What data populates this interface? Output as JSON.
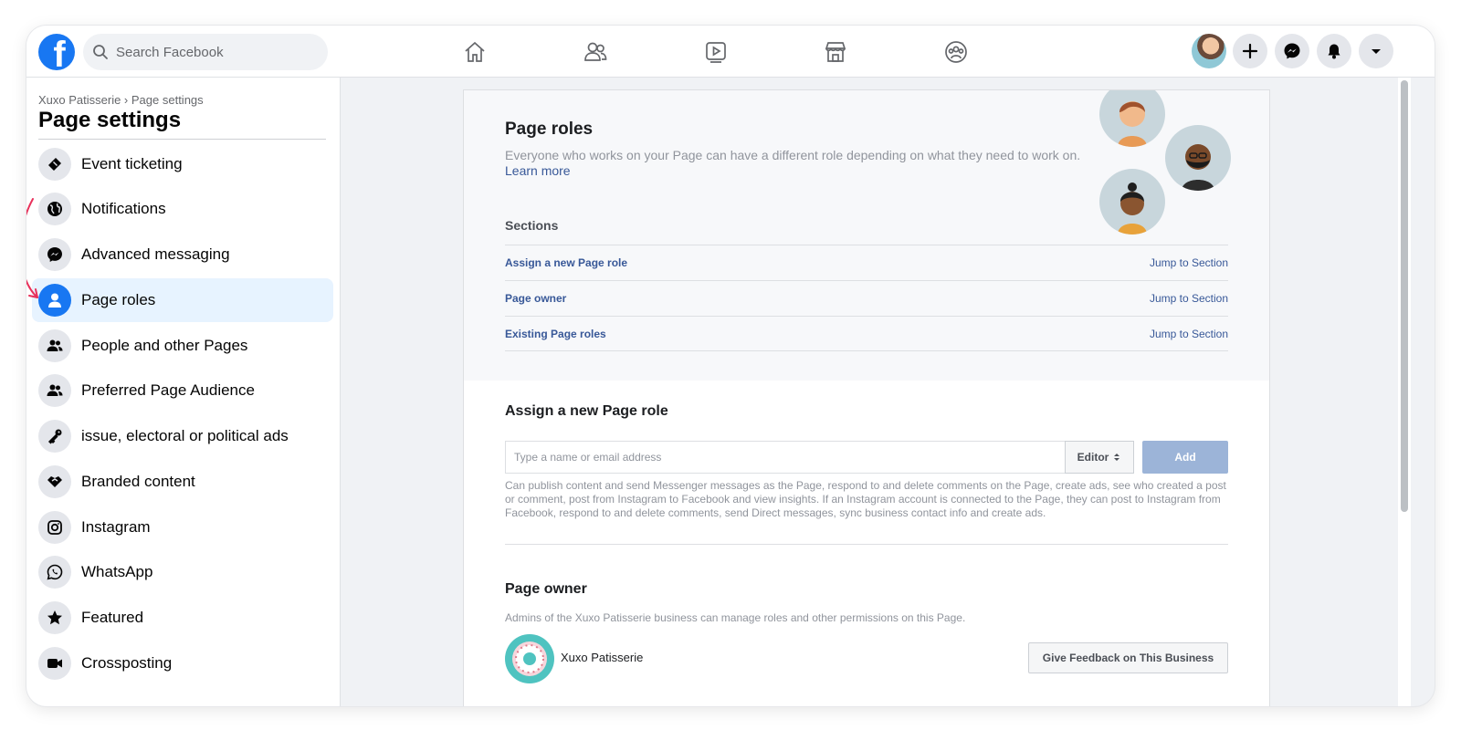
{
  "topbar": {
    "logo_letter": "f",
    "search_placeholder": "Search Facebook",
    "nav_icons": [
      "home-icon",
      "friends-icon",
      "watch-icon",
      "marketplace-icon",
      "groups-icon"
    ],
    "right_icons": [
      "profile-avatar",
      "plus-icon",
      "messenger-icon",
      "bell-icon",
      "caret-down-icon"
    ]
  },
  "sidebar": {
    "breadcrumb": "Xuxo Patisserie › Page settings",
    "title": "Page settings",
    "items": [
      {
        "label": "Event ticketing",
        "icon": "ticket-icon"
      },
      {
        "label": "Notifications",
        "icon": "globe-icon"
      },
      {
        "label": "Advanced messaging",
        "icon": "messenger-icon"
      },
      {
        "label": "Page roles",
        "icon": "person-icon",
        "active": true
      },
      {
        "label": "People and other Pages",
        "icon": "people-icon"
      },
      {
        "label": "Preferred Page Audience",
        "icon": "people-icon"
      },
      {
        "label": "issue, electoral or political ads",
        "icon": "key-icon"
      },
      {
        "label": "Branded content",
        "icon": "handshake-icon"
      },
      {
        "label": "Instagram",
        "icon": "instagram-icon"
      },
      {
        "label": "WhatsApp",
        "icon": "whatsapp-icon"
      },
      {
        "label": "Featured",
        "icon": "star-icon"
      },
      {
        "label": "Crossposting",
        "icon": "video-icon"
      }
    ]
  },
  "main": {
    "title": "Page roles",
    "description": "Everyone who works on your Page can have a different role depending on what they need to work on.",
    "learn_more": "Learn more",
    "sections_heading": "Sections",
    "sections": [
      {
        "title": "Assign a new Page role",
        "jump": "Jump to Section"
      },
      {
        "title": "Page owner",
        "jump": "Jump to Section"
      },
      {
        "title": "Existing Page roles",
        "jump": "Jump to Section"
      }
    ],
    "assign": {
      "heading": "Assign a new Page role",
      "input_placeholder": "Type a name or email address",
      "role_value": "Editor",
      "add_label": "Add",
      "help": "Can publish content and send Messenger messages as the Page, respond to and delete comments on the Page, create ads, see who created a post or comment, post from Instagram to Facebook and view insights. If an Instagram account is connected to the Page, they can post to Instagram from Facebook, respond to and delete comments, send Direct messages, sync business contact info and create ads."
    },
    "owner": {
      "heading": "Page owner",
      "description": "Admins of the Xuxo Patisserie business can manage roles and other permissions on this Page.",
      "name": "Xuxo Patisserie",
      "feedback_button": "Give Feedback on This Business"
    }
  },
  "colors": {
    "brand": "#1877f2",
    "link": "#385898",
    "active_bg": "#e7f3ff",
    "annotation_arrow": "#e8305a"
  }
}
